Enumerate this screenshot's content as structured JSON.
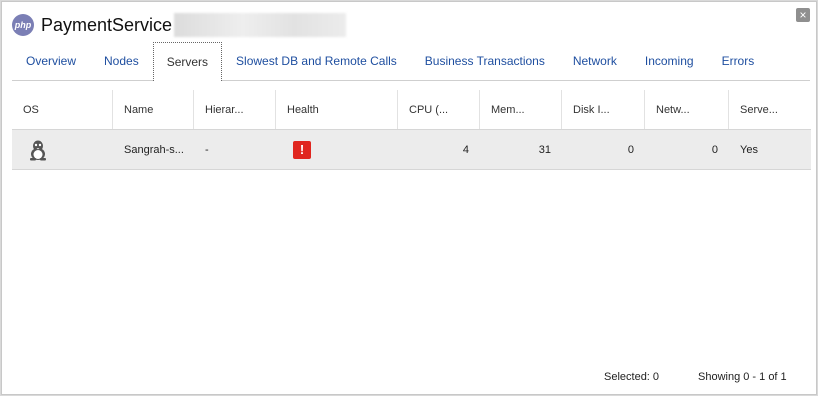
{
  "window": {
    "app_title": "PaymentService",
    "logo_text": "php",
    "close_label": "×"
  },
  "tabs": [
    {
      "label": "Overview",
      "active": false
    },
    {
      "label": "Nodes",
      "active": false
    },
    {
      "label": "Servers",
      "active": true
    },
    {
      "label": "Slowest DB and Remote Calls",
      "active": false
    },
    {
      "label": "Business Transactions",
      "active": false
    },
    {
      "label": "Network",
      "active": false
    },
    {
      "label": "Incoming",
      "active": false
    },
    {
      "label": "Errors",
      "active": false
    }
  ],
  "table": {
    "headers": [
      "OS",
      "Name",
      "Hierar...",
      "Health",
      "CPU (...",
      "Mem...",
      "Disk I...",
      "Netw...",
      "Serve..."
    ],
    "rows": [
      {
        "os_icon": "linux-tux-icon",
        "name": "Sangrah-s...",
        "hierarchy": "-",
        "health_icon": "error-alert-icon",
        "health_symbol": "!",
        "cpu": "4",
        "memory": "31",
        "disk": "0",
        "network": "0",
        "server": "Yes"
      }
    ]
  },
  "footer": {
    "selected": "Selected: 0",
    "showing": "Showing 0 - 1 of 1"
  },
  "colors": {
    "tab_link": "#1f4fa0",
    "health_error": "#e0261f",
    "php_logo": "#7b7fb5",
    "selected_row": "#ececec"
  }
}
